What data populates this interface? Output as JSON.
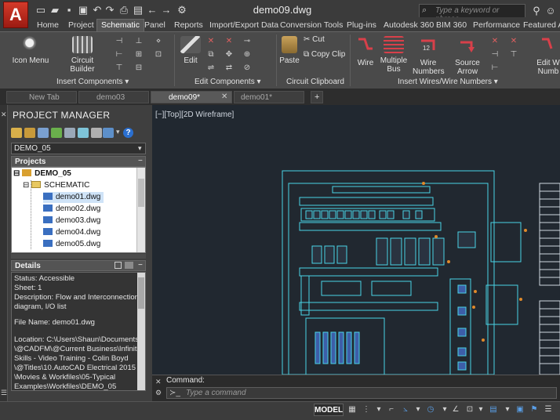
{
  "app": {
    "logo": "A",
    "document_title": "demo09.dwg"
  },
  "colors": {
    "accent_red": "#c8301f",
    "wire_red": "#d8404a",
    "drawing_cyan": "#49d3e6",
    "drawing_bg": "#212830"
  },
  "quick_access": [
    "new-icon",
    "open-icon",
    "save-icon",
    "save-as-icon",
    "undo-icon",
    "redo-icon",
    "print-icon",
    "plot-icon",
    "back-icon",
    "forward-icon",
    "workspace-icon"
  ],
  "search": {
    "placeholder": "Type a keyword or phrase"
  },
  "menu_tabs": [
    "Home",
    "Project",
    "Schematic",
    "Panel",
    "Reports",
    "Import/Export Data",
    "Conversion Tools",
    "Plug-ins",
    "Autodesk 360",
    "BIM 360",
    "Performance",
    "Featured Ap"
  ],
  "active_menu_tab": "Schematic",
  "ribbon": {
    "insert_components": {
      "title": "Insert Components",
      "icon_menu": "Icon Menu",
      "circuit_builder": "Circuit Builder"
    },
    "edit_components": {
      "title": "Edit Components",
      "edit": "Edit"
    },
    "circuit_clipboard": {
      "title": "Circuit Clipboard",
      "paste": "Paste",
      "cut": "Cut",
      "copy_clip": "Copy Clip"
    },
    "insert_wires": {
      "title": "Insert Wires/Wire Numbers",
      "wire": "Wire",
      "multiple_bus": "Multiple Bus",
      "wire_numbers": "Wire Numbers",
      "source_arrow": "Source Arrow",
      "edit_wire_numbers": "Edit W Numb"
    }
  },
  "doc_tabs": [
    "New Tab",
    "demo03",
    "demo09*",
    "demo01*"
  ],
  "active_doc_tab": "demo09*",
  "project_manager": {
    "title": "PROJECT MANAGER",
    "project_select": "DEMO_05",
    "projects_header": "Projects",
    "tree": {
      "project": "DEMO_05",
      "folder": "SCHEMATIC",
      "files": [
        "demo01.dwg",
        "demo02.dwg",
        "demo03.dwg",
        "demo04.dwg",
        "demo05.dwg"
      ]
    },
    "details_header": "Details",
    "details": {
      "status": "Status: Accessible",
      "sheet": "Sheet: 1",
      "description_1": "Description: Flow and Interconnection",
      "description_2": "diagram, I/O list",
      "file_name": "File Name: demo01.dwg",
      "location_1": "Location: C:\\Users\\Shaun\\Documents",
      "location_2": "\\@CADFM\\@Current Business\\Infinite",
      "location_3": "Skills - Video Training - Colin Boyd",
      "location_4": "\\@Titles\\10.AutoCAD Electrical 2015",
      "location_5": "\\Movies & Workfiles\\05-Typical",
      "location_6": "Examples\\Workfiles\\DEMO_05"
    }
  },
  "viewport": {
    "label": "[−][Top][2D Wireframe]"
  },
  "command": {
    "label": "Command:",
    "placeholder": "Type a command"
  },
  "status": {
    "model": "MODEL"
  }
}
